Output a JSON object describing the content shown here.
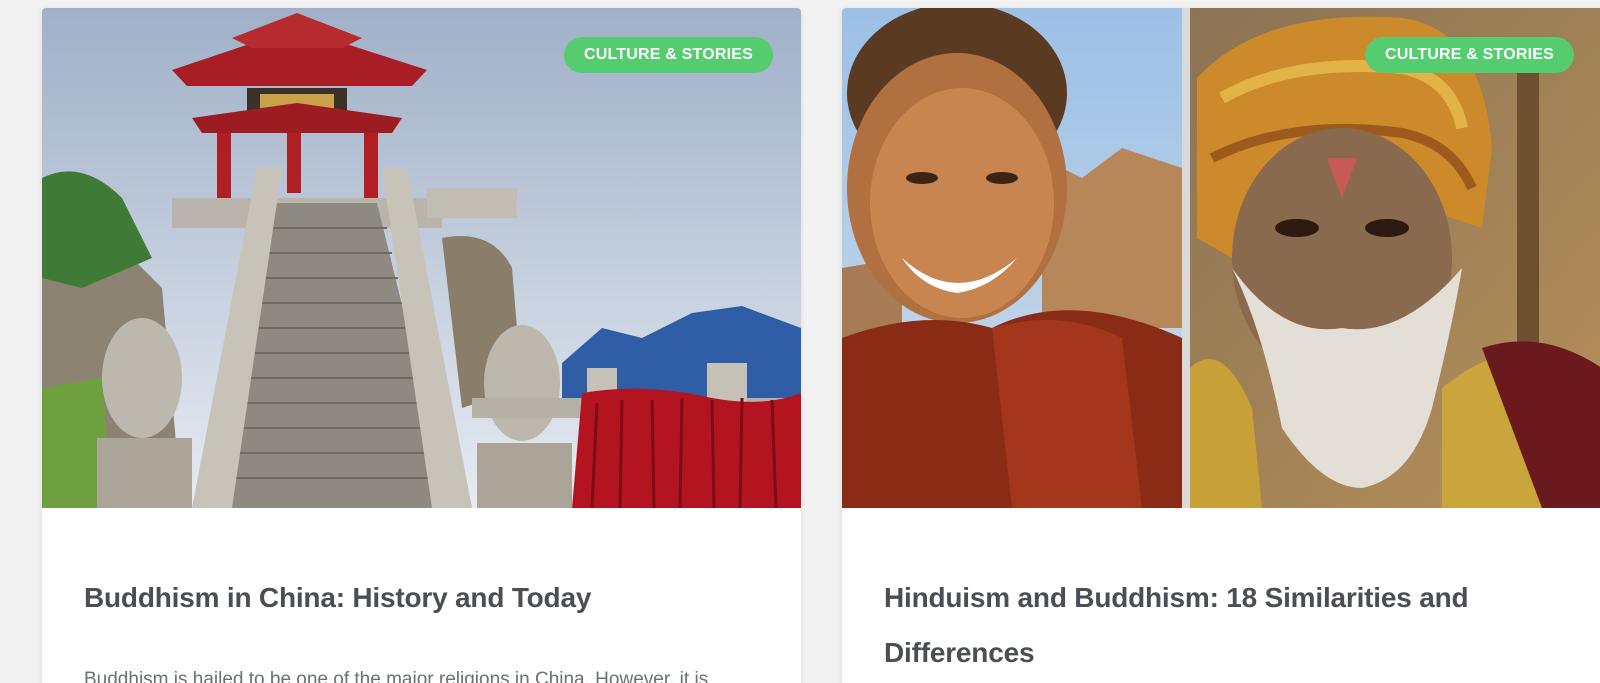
{
  "cards": [
    {
      "badge": "CULTURE & STORIES",
      "title": "Buddhism in China: History and Today",
      "excerpt": "Buddhism is hailed to be one of the major religions in China. However, it is",
      "image_subject": "chinese-pagoda-temple-stairs"
    },
    {
      "badge": "CULTURE & STORIES",
      "title": "Hinduism and Buddhism: 18 Similarities and Differences",
      "excerpt": "",
      "image_subject": "monk-boy-and-sadhu-portraits"
    }
  ],
  "colors": {
    "badge_bg": "#55cc6f",
    "title_text": "#4b4e55",
    "excerpt_text": "#6b6f76",
    "page_bg": "#f2f2f3"
  }
}
